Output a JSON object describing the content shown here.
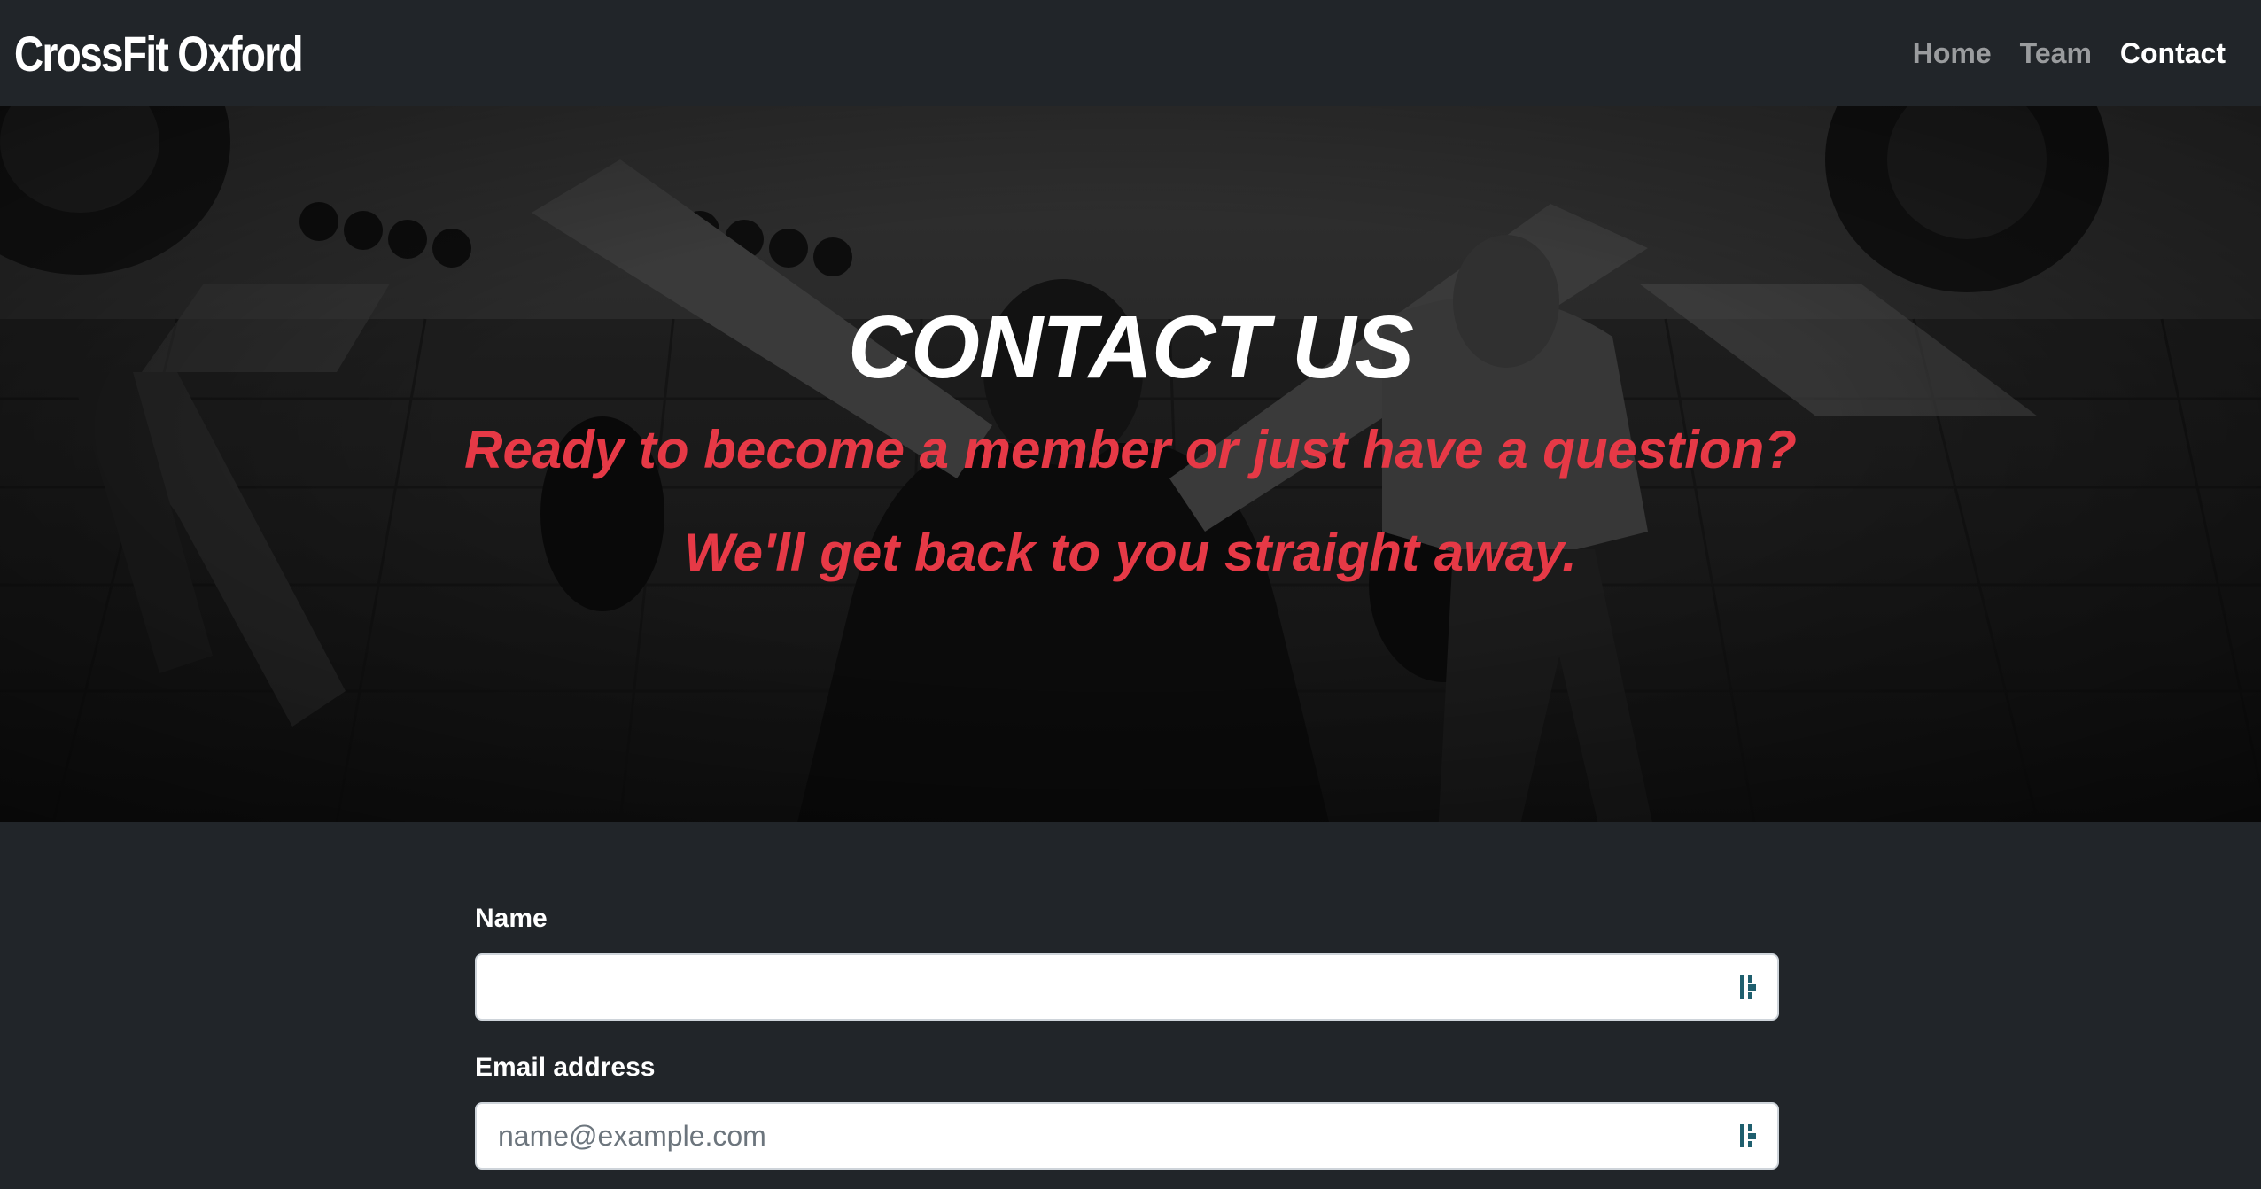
{
  "navbar": {
    "brand": "CrossFit Oxford",
    "links": [
      {
        "label": "Home",
        "active": false
      },
      {
        "label": "Team",
        "active": false
      },
      {
        "label": "Contact",
        "active": true
      }
    ]
  },
  "hero": {
    "title": "CONTACT US",
    "subtitle_line1": "Ready to become a member or just have a question?",
    "subtitle_line2": "We'll get back to you straight away.",
    "background_icon": "gym-photo-background",
    "accent_color": "#e63946"
  },
  "form": {
    "name": {
      "label": "Name",
      "value": "",
      "placeholder": ""
    },
    "email": {
      "label": "Email address",
      "value": "",
      "placeholder": "name@example.com"
    },
    "field_icon": "password-manager-icon"
  },
  "colors": {
    "page_background": "#212529",
    "text": "#ffffff",
    "nav_inactive": "rgba(255,255,255,0.55)"
  }
}
